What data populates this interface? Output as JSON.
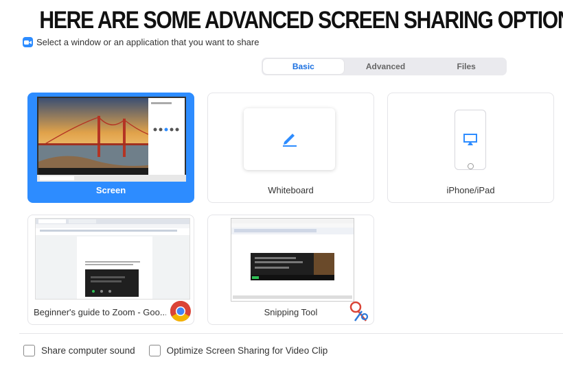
{
  "headline": "HERE ARE SOME ADVANCED SCREEN SHARING OPTIONS",
  "dialog": {
    "instruction": "Select a window or an application that you want to share"
  },
  "tabs": [
    {
      "label": "Basic",
      "active": true
    },
    {
      "label": "Advanced",
      "active": false
    },
    {
      "label": "Files",
      "active": false
    }
  ],
  "tiles": {
    "screen": {
      "label": "Screen"
    },
    "whiteboard": {
      "label": "Whiteboard"
    },
    "iphone": {
      "label": "iPhone/iPad"
    },
    "chrome_window": {
      "label": "Beginner's guide to Zoom - Goo..."
    },
    "snipping": {
      "label": "Snipping Tool"
    }
  },
  "options": {
    "share_sound": {
      "label": "Share computer sound",
      "checked": false
    },
    "optimize_video": {
      "label": "Optimize Screen Sharing for Video Clip",
      "checked": false
    }
  },
  "colors": {
    "accent": "#2d8cff",
    "active_tab_text": "#1a6fe0"
  }
}
